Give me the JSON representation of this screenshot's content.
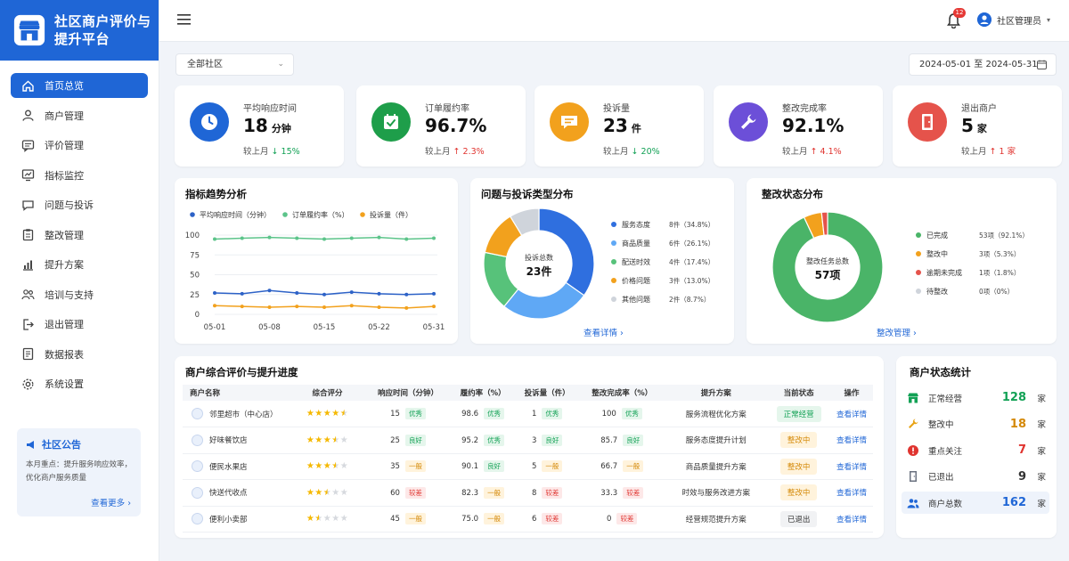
{
  "app": {
    "title": "社区商户评价与提升平台"
  },
  "nav": [
    {
      "label": "首页总览",
      "icon": "home-icon",
      "active": true
    },
    {
      "label": "商户管理",
      "icon": "user-icon"
    },
    {
      "label": "评价管理",
      "icon": "comment-icon"
    },
    {
      "label": "指标监控",
      "icon": "monitor-icon"
    },
    {
      "label": "问题与投诉",
      "icon": "chat-icon"
    },
    {
      "label": "整改管理",
      "icon": "clipboard-icon"
    },
    {
      "label": "提升方案",
      "icon": "chart-icon"
    },
    {
      "label": "培训与支持",
      "icon": "people-icon"
    },
    {
      "label": "退出管理",
      "icon": "exit-icon"
    },
    {
      "label": "数据报表",
      "icon": "report-icon"
    },
    {
      "label": "系统设置",
      "icon": "gear-icon"
    }
  ],
  "notice": {
    "title": "社区公告",
    "body": "本月重点：提升服务响应效率，优化商户服务质量",
    "more": "查看更多 ›"
  },
  "topbar": {
    "badge": "12",
    "user": "社区管理员"
  },
  "filters": {
    "community": "全部社区",
    "date_range": "2024-05-01 至 2024-05-31"
  },
  "kpis": [
    {
      "label": "平均响应时间",
      "value": "18",
      "unit": "分钟",
      "cmp_label": "较上月",
      "arrow": "↓",
      "change": "15%",
      "dir": "down",
      "color": "#1f66d6",
      "icon": "clock-icon"
    },
    {
      "label": "订单履约率",
      "value": "96.7%",
      "unit": "",
      "cmp_label": "较上月",
      "arrow": "↑",
      "change": "2.3%",
      "dir": "up",
      "color": "#1e9e4a",
      "icon": "calendar-check-icon"
    },
    {
      "label": "投诉量",
      "value": "23",
      "unit": "件",
      "cmp_label": "较上月",
      "arrow": "↓",
      "change": "20%",
      "dir": "down",
      "color": "#f2a11d",
      "icon": "message-icon"
    },
    {
      "label": "整改完成率",
      "value": "92.1%",
      "unit": "",
      "cmp_label": "较上月",
      "arrow": "↑",
      "change": "4.1%",
      "dir": "up",
      "color": "#6c4fd8",
      "icon": "wrench-icon"
    },
    {
      "label": "退出商户",
      "value": "5",
      "unit": "家",
      "cmp_label": "较上月",
      "arrow": "↑",
      "change": "1 家",
      "dir": "up",
      "color": "#e5534b",
      "icon": "door-icon"
    }
  ],
  "trend": {
    "title": "指标趋势分析"
  },
  "issues": {
    "title": "问题与投诉类型分布",
    "view": "查看详情 ›"
  },
  "fix": {
    "title": "整改状态分布",
    "view": "整改管理 ›"
  },
  "chart_data": [
    {
      "type": "line",
      "x": [
        "05-01",
        "05-04",
        "05-08",
        "05-11",
        "05-15",
        "05-18",
        "05-22",
        "05-25",
        "05-31"
      ],
      "tick_labels": [
        "05-01",
        "05-08",
        "05-15",
        "05-22",
        "05-31"
      ],
      "ylim": [
        0,
        100
      ],
      "yticks": [
        0,
        25,
        50,
        75,
        100
      ],
      "legend": "top",
      "series": [
        {
          "name": "平均响应时间（分钟）",
          "color": "#2d62c7",
          "values": [
            27,
            26,
            30,
            27,
            25,
            28,
            26,
            25,
            26
          ]
        },
        {
          "name": "订单履约率（%）",
          "color": "#5cc48a",
          "values": [
            95,
            96,
            97,
            96,
            95,
            96,
            97,
            95,
            96
          ]
        },
        {
          "name": "投诉量（件）",
          "color": "#f2a11d",
          "values": [
            11,
            10,
            9,
            10,
            9,
            11,
            9,
            8,
            10
          ]
        }
      ]
    },
    {
      "type": "pie",
      "center_label": "投诉总数",
      "center_value": "23件",
      "slices": [
        {
          "name": "服务态度",
          "value": 8,
          "display": "8件（34.8%）",
          "color": "#2f6fdf"
        },
        {
          "name": "商品质量",
          "value": 6,
          "display": "6件（26.1%）",
          "color": "#5fa8f5"
        },
        {
          "name": "配送时效",
          "value": 4,
          "display": "4件（17.4%）",
          "color": "#57c27a"
        },
        {
          "name": "价格问题",
          "value": 3,
          "display": "3件（13.0%）",
          "color": "#f2a11d"
        },
        {
          "name": "其他问题",
          "value": 2,
          "display": "2件（8.7%）",
          "color": "#cfd4db"
        }
      ]
    },
    {
      "type": "pie",
      "center_label": "整改任务总数",
      "center_value": "57项",
      "slices": [
        {
          "name": "已完成",
          "value": 53,
          "display": "53项（92.1%）",
          "color": "#4ab468"
        },
        {
          "name": "整改中",
          "value": 3,
          "display": "3项（5.3%）",
          "color": "#f2a11d"
        },
        {
          "name": "逾期未完成",
          "value": 1,
          "display": "1项（1.8%）",
          "color": "#e5534b"
        },
        {
          "name": "待整改",
          "value": 0,
          "display": "0项（0%）",
          "color": "#cfd4db"
        }
      ]
    }
  ],
  "table": {
    "title": "商户综合评价与提升进度",
    "columns": [
      "商户名称",
      "综合评分",
      "响应时间（分钟）",
      "履约率（%）",
      "投诉量（件）",
      "整改完成率（%）",
      "提升方案",
      "当前状态",
      "操作"
    ],
    "rows": [
      {
        "name": "邻里超市（中心店）",
        "stars": 4.5,
        "resp": "15",
        "resp_tag": "优秀",
        "resp_cls": "tag-good",
        "rate": "98.6",
        "rate_tag": "优秀",
        "rate_cls": "tag-good",
        "comp": "1",
        "comp_tag": "优秀",
        "comp_cls": "tag-good",
        "fix": "100",
        "fix_tag": "优秀",
        "fix_cls": "tag-good",
        "plan": "服务流程优化方案",
        "status": "正常经营",
        "status_cls": "st-normal",
        "op": "查看详情"
      },
      {
        "name": "好味餐饮店",
        "stars": 3.5,
        "resp": "25",
        "resp_tag": "良好",
        "resp_cls": "tag-ok",
        "rate": "95.2",
        "rate_tag": "优秀",
        "rate_cls": "tag-good",
        "comp": "3",
        "comp_tag": "良好",
        "comp_cls": "tag-ok",
        "fix": "85.7",
        "fix_tag": "良好",
        "fix_cls": "tag-ok",
        "plan": "服务态度提升计划",
        "status": "整改中",
        "status_cls": "st-fix",
        "op": "查看详情"
      },
      {
        "name": "便民水果店",
        "stars": 3.5,
        "resp": "35",
        "resp_tag": "一般",
        "resp_cls": "tag-avg",
        "rate": "90.1",
        "rate_tag": "良好",
        "rate_cls": "tag-ok",
        "comp": "5",
        "comp_tag": "一般",
        "comp_cls": "tag-avg",
        "fix": "66.7",
        "fix_tag": "一般",
        "fix_cls": "tag-avg",
        "plan": "商品质量提升方案",
        "status": "整改中",
        "status_cls": "st-fix",
        "op": "查看详情"
      },
      {
        "name": "快送代收点",
        "stars": 2.5,
        "resp": "60",
        "resp_tag": "较差",
        "resp_cls": "tag-bad",
        "rate": "82.3",
        "rate_tag": "一般",
        "rate_cls": "tag-avg",
        "comp": "8",
        "comp_tag": "较差",
        "comp_cls": "tag-bad",
        "fix": "33.3",
        "fix_tag": "较差",
        "fix_cls": "tag-bad",
        "plan": "时效与服务改进方案",
        "status": "整改中",
        "status_cls": "st-fix",
        "op": "查看详情"
      },
      {
        "name": "便利小卖部",
        "stars": 1.5,
        "resp": "45",
        "resp_tag": "一般",
        "resp_cls": "tag-avg",
        "rate": "75.0",
        "rate_tag": "一般",
        "rate_cls": "tag-avg",
        "comp": "6",
        "comp_tag": "较差",
        "comp_cls": "tag-bad",
        "fix": "0",
        "fix_tag": "较差",
        "fix_cls": "tag-bad",
        "plan": "经营规范提升方案",
        "status": "已退出",
        "status_cls": "st-exit",
        "op": "查看详情"
      }
    ]
  },
  "stats": {
    "title": "商户状态统计",
    "rows": [
      {
        "label": "正常经营",
        "value": "128",
        "unit": "家",
        "color": "#12a155",
        "icon": "shop-icon"
      },
      {
        "label": "整改中",
        "value": "18",
        "unit": "家",
        "color": "#d48806",
        "icon": "wrench-icon"
      },
      {
        "label": "重点关注",
        "value": "7",
        "unit": "家",
        "color": "#e0342f",
        "icon": "alert-icon"
      },
      {
        "label": "已退出",
        "value": "9",
        "unit": "家",
        "color": "#333333",
        "icon": "exit-icon"
      },
      {
        "label": "商户总数",
        "value": "162",
        "unit": "家",
        "color": "#1f66d6",
        "icon": "people-icon"
      }
    ]
  }
}
